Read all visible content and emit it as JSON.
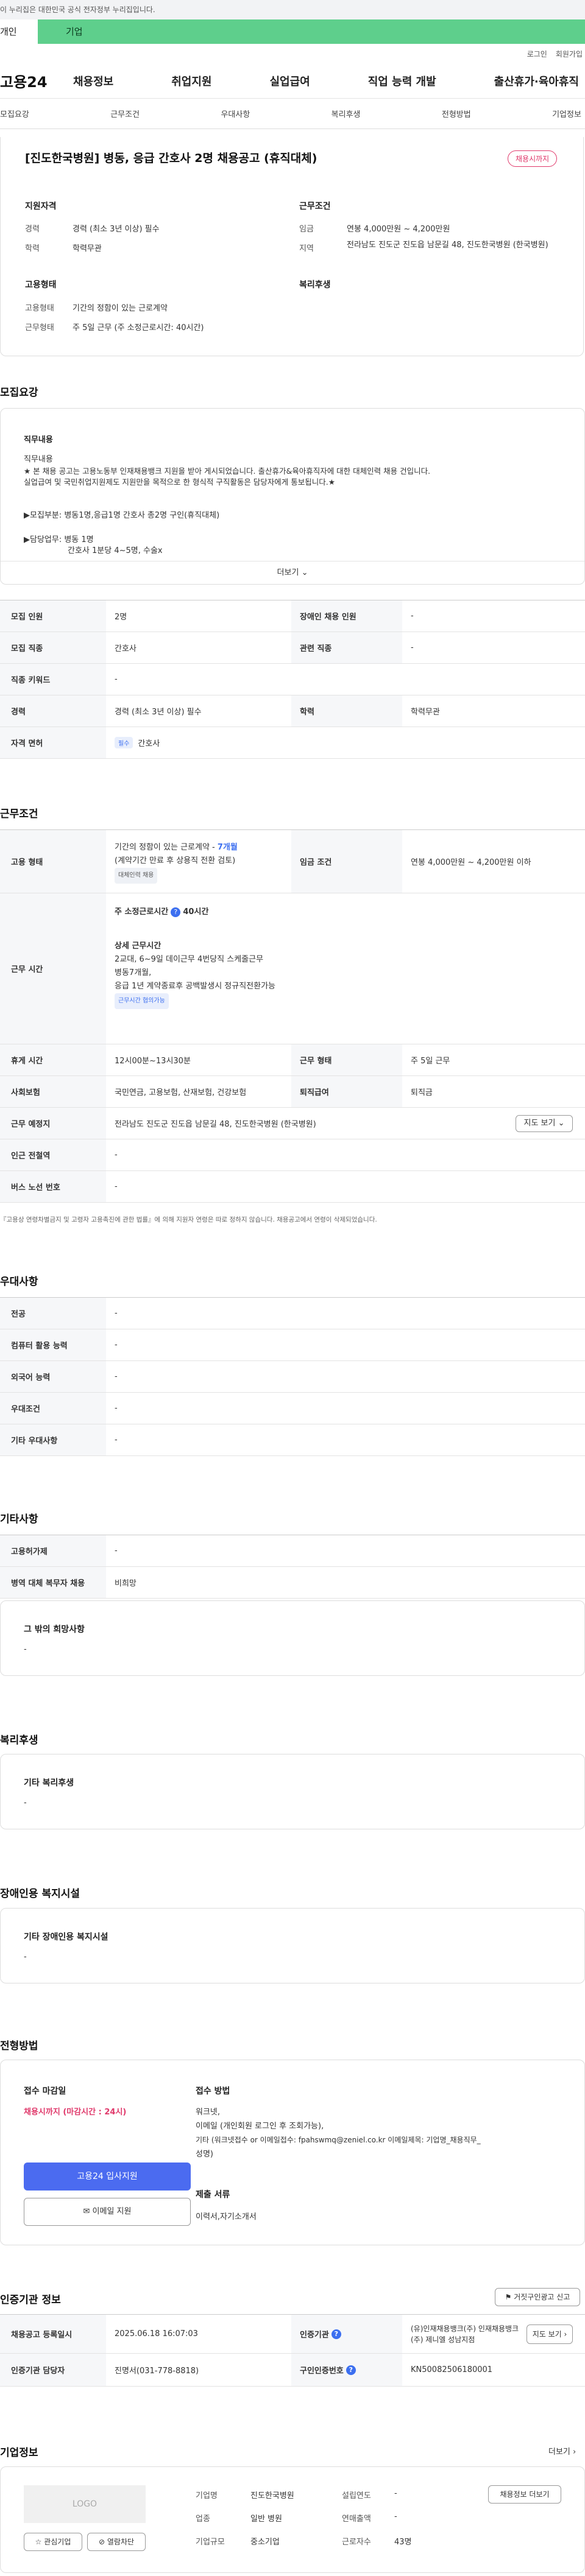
{
  "banner": {
    "text": "이 누리집은 대한민국 공식 전자정부 누리집입니다."
  },
  "top_tabs": {
    "personal": "개인",
    "company": "기업"
  },
  "util": {
    "login": "로그인",
    "signup": "회원가입"
  },
  "logo": "고용24",
  "gnb": [
    "채용정보",
    "취업지원",
    "실업급여",
    "직업 능력 개발",
    "출산휴가·육아휴직"
  ],
  "subnav": [
    "모집요강",
    "근무조건",
    "우대사항",
    "복리후생",
    "전형방법",
    "기업정보"
  ],
  "job": {
    "title": "[진도한국병원] 병동, 응급 간호사 2명 채용공고 (휴직대체)",
    "status_badge": "채용시까지",
    "qual_heading": "지원자격",
    "experience_label": "경력",
    "experience_value": "경력 (최소 3년 이상) 필수",
    "education_label": "학력",
    "education_value": "학력무관",
    "cond_heading": "근무조건",
    "wage_label": "임금",
    "wage_value": "연봉 4,000만원 ~ 4,200만원",
    "region_label": "지역",
    "region_value": "전라남도 진도군 진도읍 남문길 48, 진도한국병원 (한국병원)",
    "form_heading": "고용형태",
    "emp_type_label": "고용형태",
    "emp_type_value": "기간의 정함이 있는 근로계약",
    "work_form_label": "근무형태",
    "work_form_value": "주 5일 근무 (주 소정근로시간: 40시간)",
    "welfare_heading": "복리후생"
  },
  "recruit": {
    "heading": "모집요강",
    "content_label": "직무내용",
    "content_lines": [
      "직무내용",
      "★ 본 채용 공고는 고용노동부 인재채용뱅크 지원을 받아 게시되었습니다. 출산휴가&육아휴직자에 대한 대체인력 채용 건입니다.",
      "실업급여 및 국민취업지원제도 지원만을 목적으로 한 형식적 구직활동은 담당자에게 통보됩니다.★",
      "▶모집부분: 병동1명,응급1명 간호사 총2명 구인(휴직대체)",
      "▶담당업무: 병동 1명",
      "간호사 1분당 4~5명, 수술x"
    ],
    "more": "더보기",
    "rows": [
      {
        "l1": "모집 인원",
        "v1": "2명",
        "l2": "장애인 채용 인원",
        "v2": "-"
      },
      {
        "l1": "모집 직종",
        "v1": "간호사",
        "l2": "관련 직종",
        "v2": "-"
      },
      {
        "l1": "직종 키워드",
        "v1": "-"
      },
      {
        "l1": "경력",
        "v1": "경력 (최소 3년 이상) 필수",
        "l2": "학력",
        "v2": "학력무관"
      },
      {
        "l1": "자격 면허",
        "badge": "필수",
        "v1": "간호사"
      }
    ]
  },
  "work": {
    "heading": "근무조건",
    "emp_label": "고용 형태",
    "emp_line1": "기간의 정함이 있는 근로계약 - ",
    "emp_months": "7개월",
    "emp_line2": "(계약기간 만료 후 상용직 전환 검토)",
    "emp_badge": "대체인력 채용",
    "wage_label": "임금 조건",
    "wage_value": "연봉 4,000만원 ~ 4,200만원 이하",
    "time_label": "근무 시간",
    "time_main": "주 소정근로시간",
    "time_hours": "40시간",
    "detail_heading": "상세 근무시간",
    "detail_lines": [
      "2교대, 6~9일 데이근무 4번당직 스케줄근무",
      "병동7개월,",
      "응급 1년 계약종료후 공백발생시 정규직전환가능"
    ],
    "detail_badge": "근무시간 협의가능",
    "rows": [
      {
        "l1": "휴게 시간",
        "v1": "12시00분~13시30분",
        "l2": "근무 형태",
        "v2": "주 5일 근무"
      },
      {
        "l1": "사회보험",
        "v1": "국민연금, 고용보험, 산재보험, 건강보험",
        "l2": "퇴직급여",
        "v2": "퇴직금"
      }
    ],
    "place_label": "근무 예정지",
    "place_value": "전라남도 진도군 진도읍 남문길 48, 진도한국병원 (한국병원)",
    "map_button": "지도 보기",
    "station_label": "인근 전철역",
    "station_value": "-",
    "bus_label": "버스 노선 번호",
    "bus_value": "-",
    "note": "『고용상 연령차별금지 및 고령자 고용촉진에 관한 법률』에 의해 지원자 연령은 따로 정하지 않습니다. 채용공고에서 연령이 삭제되었습니다."
  },
  "pref": {
    "heading": "우대사항",
    "rows": [
      {
        "l": "전공",
        "v": "-"
      },
      {
        "l": "컴퓨터 활용 능력",
        "v": "-"
      },
      {
        "l": "외국어 능력",
        "v": "-"
      },
      {
        "l": "우대조건",
        "v": "-"
      },
      {
        "l": "기타 우대사항",
        "v": "-"
      }
    ]
  },
  "etc": {
    "heading": "기타사항",
    "rows": [
      {
        "l": "고용허가제",
        "v": "-"
      },
      {
        "l": "병역 대체 복무자 채용",
        "v": "비희망"
      }
    ],
    "other_heading": "그 밖의 희망사항",
    "other_value": "-"
  },
  "welfare": {
    "heading": "복리후생",
    "box_heading": "기타 복리후생",
    "box_value": "-"
  },
  "disabled": {
    "heading": "장애인용 복지시설",
    "box_heading": "기타 장애인용 복지시설",
    "box_value": "-"
  },
  "selection": {
    "heading": "전형방법",
    "deadline_label": "접수 마감일",
    "deadline_value": "채용시까지 (마감시간 : 24시)",
    "apply_button": "고용24 입사지원",
    "email_button": "이메일 지원",
    "method_label": "접수 방법",
    "method_lines": [
      "워크넷,",
      "이메일 (개인회원 로그인 후 조회가능),",
      "기타 (워크넷접수 or 이메일접수: fpahswmq@zeniel.co.kr 이메일제목: 기업명_채용직무_",
      "성명)"
    ],
    "docs_label": "제출 서류",
    "docs_value": "이력서,자기소개서"
  },
  "cert": {
    "heading": "인증기관 정보",
    "report_button": "거짓구인광고 신고",
    "reg_label": "채용공고 등록일시",
    "reg_value": "2025.06.18 16:07:03",
    "agency_label": "인증기관",
    "agency_value": "(유)인재채용뱅크(주) 인재채용뱅크(주) 제니엘 성남지점",
    "map_button": "지도 보기",
    "manager_label": "인증기관 담당자",
    "manager_value": "진명서(031-778-8818)",
    "cert_no_label": "구인인증번호",
    "cert_no_value": "KN50082506180001"
  },
  "company": {
    "heading": "기업정보",
    "more": "더보기",
    "logo_text": "LOGO",
    "interest_button": "관심기업",
    "block_button": "열람차단",
    "list_button": "채용정보 더보기",
    "name_label": "기업명",
    "name_value": "진도한국병원",
    "industry_label": "업종",
    "industry_value": "일반 병원",
    "size_label": "기업규모",
    "size_value": "중소기업",
    "founded_label": "설립연도",
    "founded_value": "-",
    "sales_label": "연매출액",
    "sales_value": "-",
    "employees_label": "근로자수",
    "employees_value": "43명"
  }
}
